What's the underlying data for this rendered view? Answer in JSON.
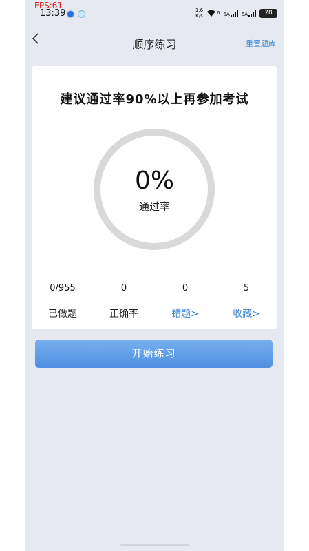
{
  "status_bar": {
    "fps": "FPS:61",
    "time": "13:39",
    "net_speed_top": "1.6",
    "net_speed_bottom": "K/s",
    "wifi_tag": "6",
    "sim1_tag": "5A",
    "sim2_tag": "5A",
    "battery": "78"
  },
  "nav": {
    "back_glyph": "<",
    "title": "顺序练习",
    "reset_label": "重置题库"
  },
  "card": {
    "headline": "建议通过率90%以上再参加考试",
    "progress": {
      "value_text": "0%",
      "label": "通过率",
      "fraction": 0
    },
    "stats": [
      {
        "value": "0/955",
        "label": "已做题"
      },
      {
        "value": "0",
        "label": "正确率"
      },
      {
        "value": "0",
        "label": "错题>"
      },
      {
        "value": "5",
        "label": "收藏>"
      }
    ]
  },
  "start_button": {
    "label": "开始练习"
  },
  "colors": {
    "accent": "#3a86d8",
    "button_top": "#78b0ef",
    "button_bottom": "#4f8fe2",
    "ring": "#d9d9d9"
  },
  "icons": {
    "back": "back-arrow-icon",
    "wifi": "wifi-icon",
    "signal": "signal-icon",
    "battery": "battery-icon"
  }
}
